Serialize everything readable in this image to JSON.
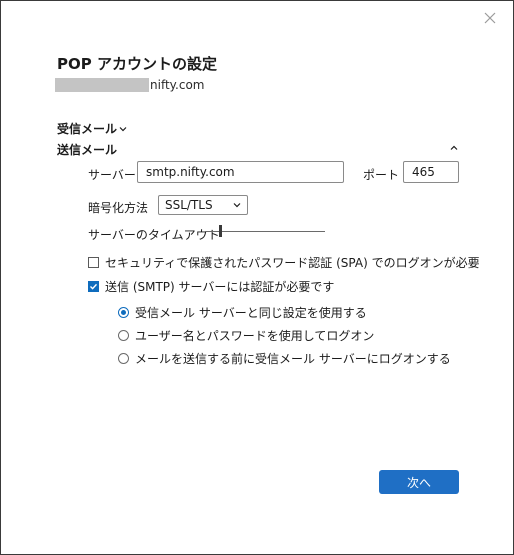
{
  "dialog": {
    "title": "POP アカウントの設定",
    "email_domain": "nifty.com"
  },
  "sections": {
    "incoming_label": "受信メール",
    "outgoing_label": "送信メール"
  },
  "outgoing": {
    "server_label": "サーバー",
    "server_value": "smtp.nifty.com",
    "port_label": "ポート",
    "port_value": "465",
    "encryption_label": "暗号化方法",
    "encryption_value": "SSL/TLS",
    "timeout_label": "サーバーのタイムアウト",
    "timeout_level": 0.12,
    "spa_label": "セキュリティで保護されたパスワード認証 (SPA) でのログオンが必要",
    "spa_checked": false,
    "auth_required_label": "送信 (SMTP) サーバーには認証が必要です",
    "auth_required_checked": true,
    "auth_options": [
      {
        "label": "受信メール サーバーと同じ設定を使用する",
        "selected": true
      },
      {
        "label": "ユーザー名とパスワードを使用してログオン",
        "selected": false
      },
      {
        "label": "メールを送信する前に受信メール サーバーにログオンする",
        "selected": false
      }
    ]
  },
  "buttons": {
    "next_label": "次へ"
  },
  "icons": {
    "close": "close-icon",
    "expand": "chevron-down-icon",
    "collapse": "chevron-up-icon",
    "dropdown": "chevron-down-icon",
    "check": "checkmark-icon"
  },
  "colors": {
    "accent": "#0f6cbd",
    "button": "#1f6fc5",
    "redaction": "#c4c4c4"
  }
}
